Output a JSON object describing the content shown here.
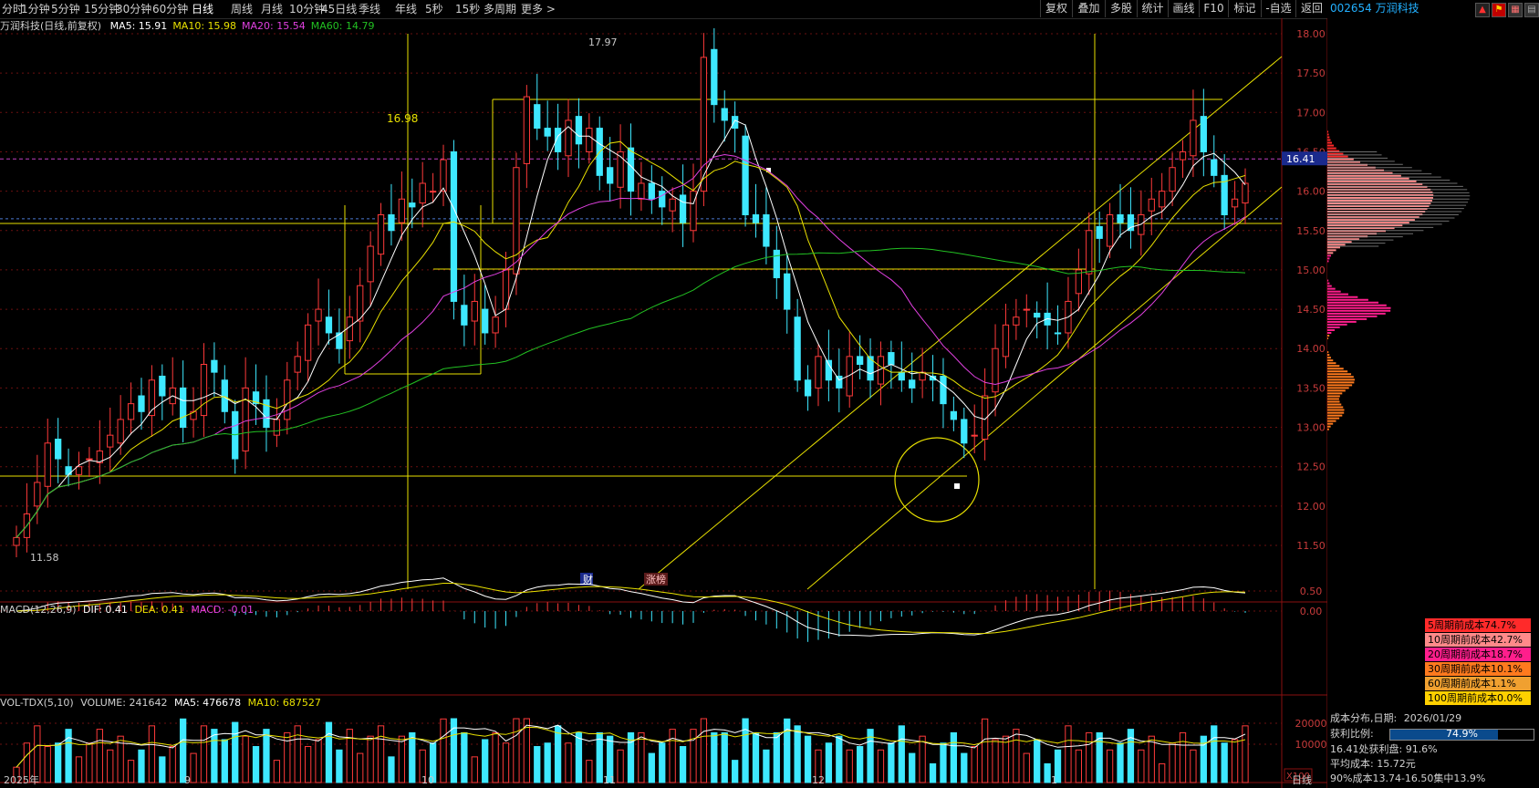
{
  "toolbar": {
    "period_tabs": [
      "分时",
      "1分钟",
      "5分钟",
      "15分钟",
      "30分钟",
      "60分钟",
      "日线",
      "周线",
      "月线",
      "10分钟",
      "45日线",
      "季线",
      "年线",
      "5秒",
      "15秒",
      "多周期",
      "更多 >"
    ],
    "active_tab": "日线",
    "right_buttons": [
      "复权",
      "叠加",
      "多股",
      "统计",
      "画线",
      "F10",
      "标记",
      "-自选",
      "返回"
    ]
  },
  "side_header": {
    "stock_code": "002654",
    "stock_name": "万润科技"
  },
  "main_chart": {
    "title": "万润科技(日线,前复权)",
    "ma_labels": [
      {
        "text": "MA5: 15.91",
        "color": "#ffffff"
      },
      {
        "text": "MA10: 15.98",
        "color": "#e8e000"
      },
      {
        "text": "MA20: 15.54",
        "color": "#e040e0"
      },
      {
        "text": "MA60: 14.79",
        "color": "#22c022"
      }
    ],
    "y_ticks": [
      "18.00",
      "17.50",
      "17.00",
      "16.50",
      "16.00",
      "15.50",
      "15.00",
      "14.50",
      "14.00",
      "13.50",
      "13.00",
      "12.50",
      "12.00",
      "11.50"
    ],
    "current_price_tag": "16.41",
    "high_label": "17.97",
    "low_label": "11.58",
    "annotation_1698": "16.98",
    "event_tag_cai": "财",
    "event_tag_zhangbang": "涨榜"
  },
  "macd_panel": {
    "title": "MACD(12,26,9)",
    "dif": "DIF: 0.41",
    "dea": "DEA: 0.41",
    "macd": "MACD: -0.01",
    "y_ticks": [
      "0.50",
      "0.00"
    ]
  },
  "volume_panel": {
    "title": "VOL-TDX(5,10)",
    "volume": "VOLUME: 241642",
    "ma5": "MA5: 476678",
    "ma10": "MA10: 687527",
    "y_ticks": [
      "20000",
      "10000"
    ],
    "unit": "X100"
  },
  "x_axis": {
    "labels": [
      "2025年",
      "9",
      "10",
      "11",
      "12",
      "1"
    ],
    "period_label": "日线"
  },
  "chip_distribution": {
    "legend": [
      {
        "text": "5周期前成本74.7%",
        "color": "#ff2a2a"
      },
      {
        "text": "10周期前成本42.7%",
        "color": "#ff8a8a"
      },
      {
        "text": "20周期前成本18.7%",
        "color": "#ff1e8c"
      },
      {
        "text": "30周期前成本10.1%",
        "color": "#ff7a1e"
      },
      {
        "text": "60周期前成本1.1%",
        "color": "#f0a030"
      },
      {
        "text": "100周期前成本0.0%",
        "color": "#ffd000"
      }
    ],
    "date_label": "成本分布,日期:",
    "date_value": "2026/01/29",
    "profit_ratio_label": "获利比例:",
    "profit_ratio_value": "74.9%",
    "profit_ratio": 0.749,
    "price_profit": "16.41处获利盘: 91.6%",
    "avg_cost": "平均成本: 15.72元",
    "concentration": "90%成本13.74-16.50集中13.9%"
  }
}
